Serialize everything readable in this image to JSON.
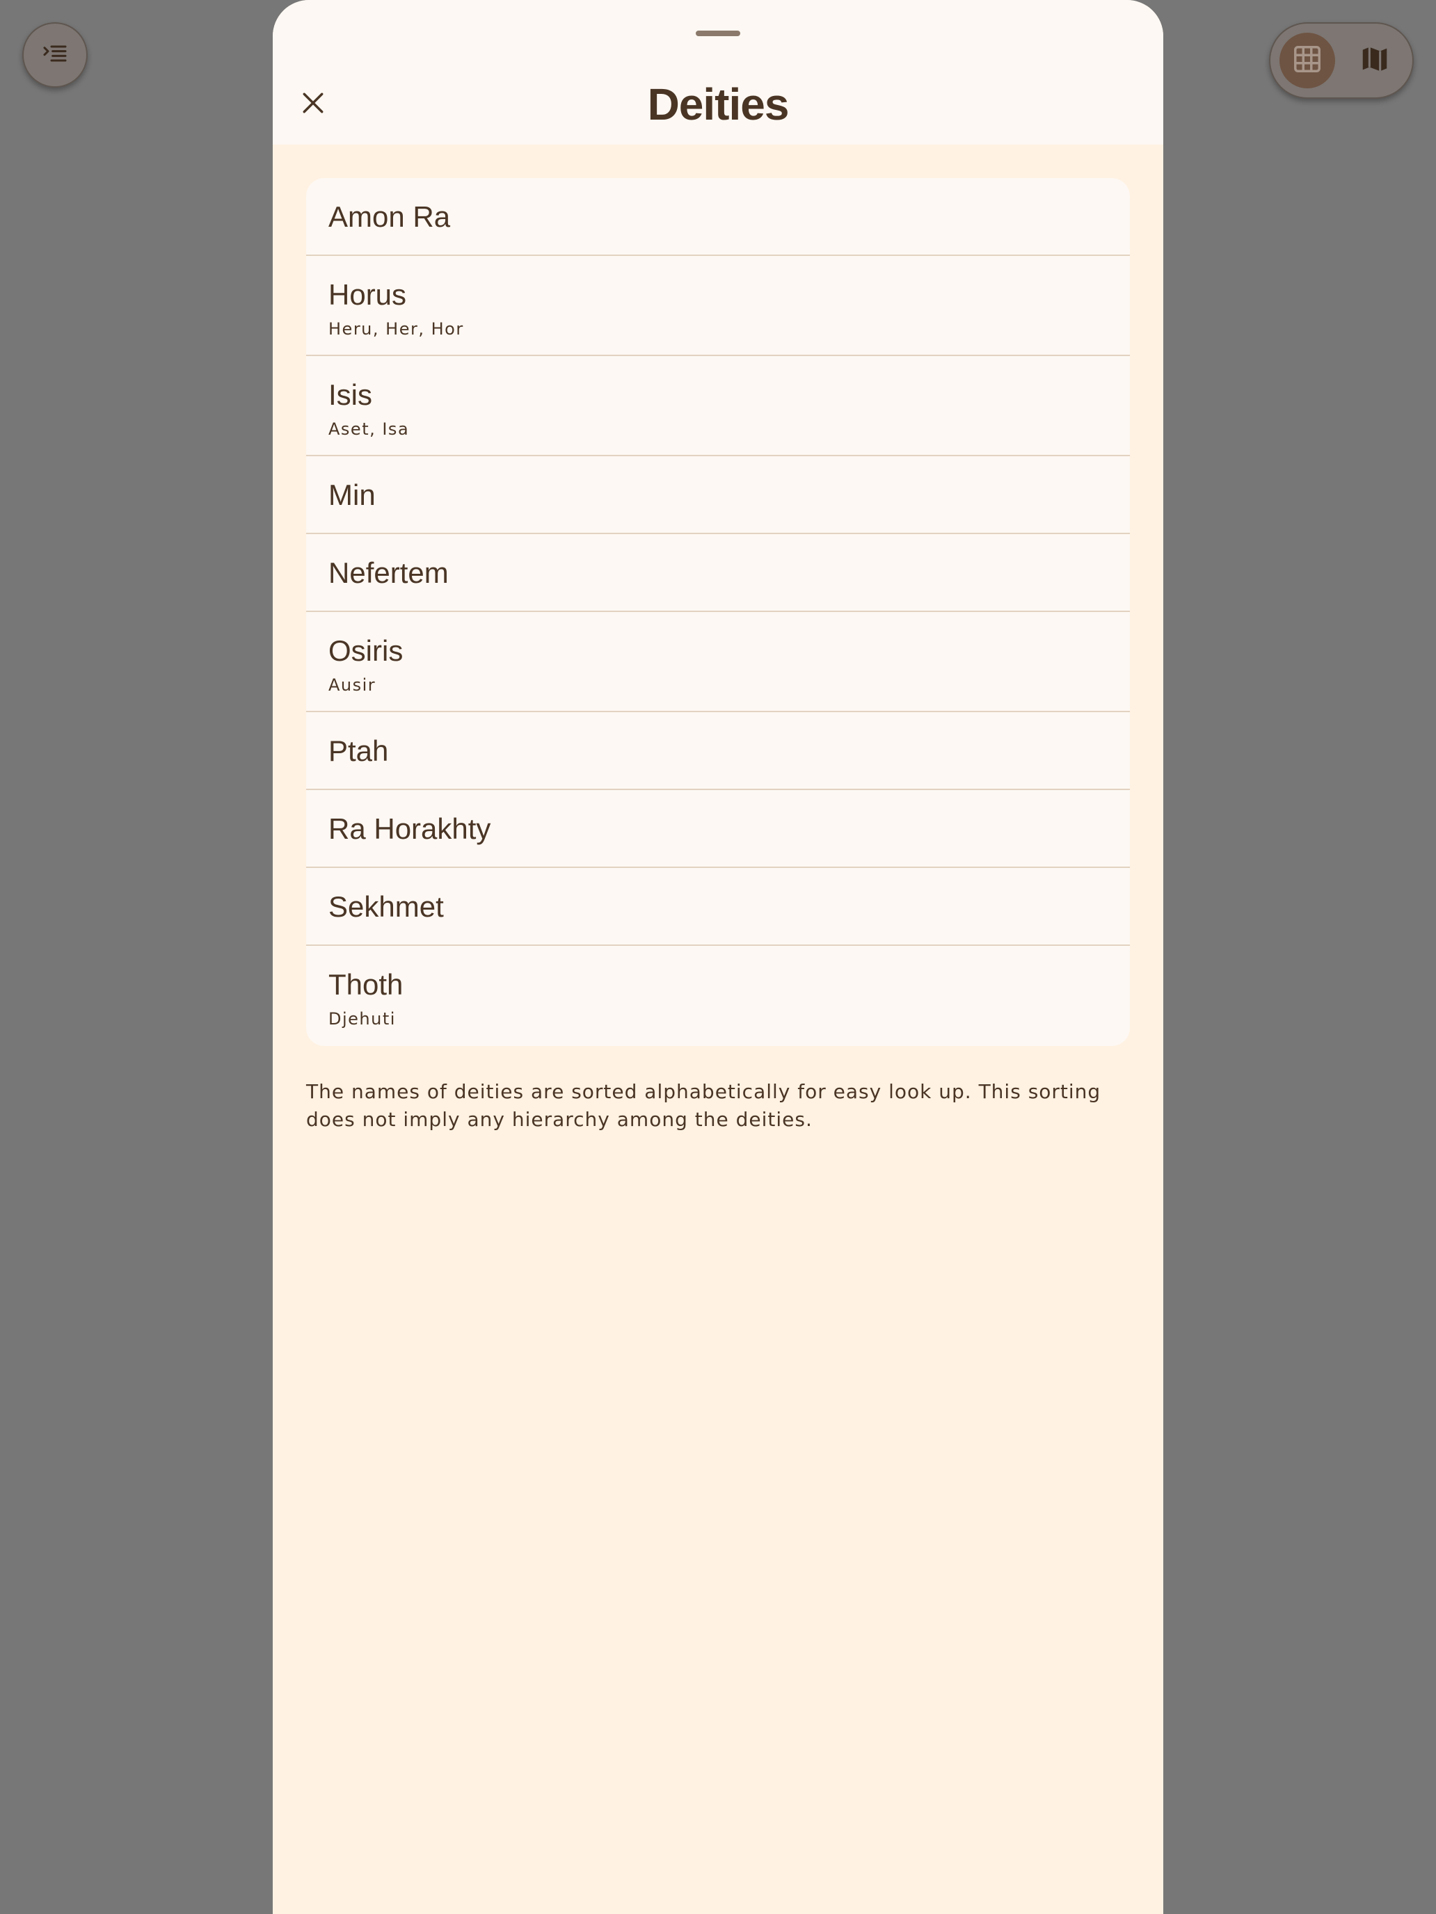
{
  "header": {
    "title": "Deities",
    "close_icon": "close-icon",
    "drag_handle": "drag-handle"
  },
  "controls": {
    "menu_icon": "indent-list-icon",
    "grid_view_icon": "grid-icon",
    "map_view_icon": "map-icon",
    "selected_view": "grid"
  },
  "deities": [
    {
      "name": "Amon Ra",
      "alt": ""
    },
    {
      "name": "Horus",
      "alt": "Heru, Her, Hor"
    },
    {
      "name": "Isis",
      "alt": "Aset, Isa"
    },
    {
      "name": "Min",
      "alt": ""
    },
    {
      "name": "Nefertem",
      "alt": ""
    },
    {
      "name": "Osiris",
      "alt": "Ausir"
    },
    {
      "name": "Ptah",
      "alt": ""
    },
    {
      "name": "Ra Horakhty",
      "alt": ""
    },
    {
      "name": "Sekhmet",
      "alt": ""
    },
    {
      "name": "Thoth",
      "alt": "Djehuti"
    }
  ],
  "footnote": "The names of deities are sorted alphabetically for easy look up. This sorting does not imply any hierarchy among the deities.",
  "colors": {
    "backdrop": "#777777",
    "sheet_background": "#fff2e2",
    "card_background": "#fdf8f3",
    "text": "#4a3525",
    "divider": "#e2d2c0",
    "toggle_selected": "#6e5443"
  }
}
